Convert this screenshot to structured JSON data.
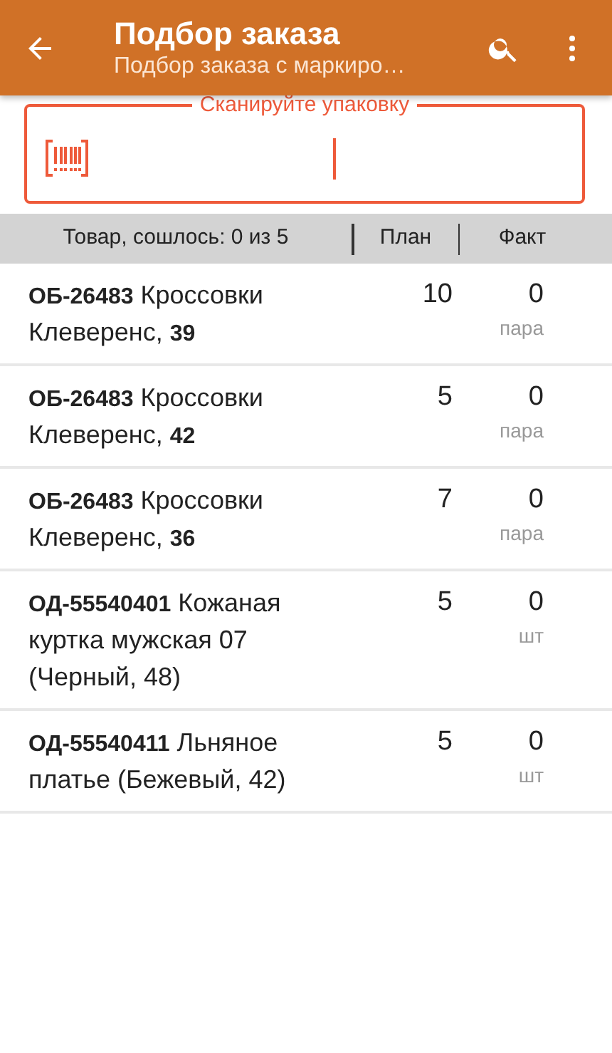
{
  "app_bar": {
    "title": "Подбор заказа",
    "subtitle": "Подбор заказа с маркиро…"
  },
  "scan_field": {
    "label": "Сканируйте упаковку"
  },
  "table": {
    "columns": [
      "Товар, сошлось: 0 из 5",
      "План",
      "Факт"
    ],
    "rows": [
      {
        "name": "**ОБ-26483** Кроссовки Клеверенс, **39**",
        "plan": "10",
        "fact": "0",
        "unit": "пара"
      },
      {
        "name": "**ОБ-26483** Кроссовки Клеверенс, **42**",
        "plan": "5",
        "fact": "0",
        "unit": "пара"
      },
      {
        "name": "**ОБ-26483** Кроссовки Клеверенс, **36**",
        "plan": "7",
        "fact": "0",
        "unit": "пара"
      },
      {
        "name": "**ОД-55540401** Кожаная куртка мужская 07 (Черный, 48)",
        "plan": "5",
        "fact": "0",
        "unit": "шт"
      },
      {
        "name": "**ОД-55540411** Льняное платье (Бежевый, 42)",
        "plan": "5",
        "fact": "0",
        "unit": "шт"
      }
    ]
  }
}
